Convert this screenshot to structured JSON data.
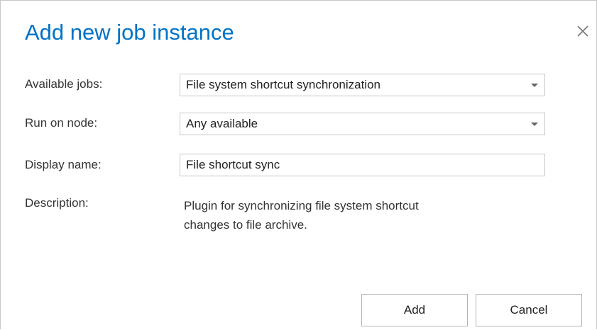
{
  "dialog": {
    "title": "Add new job instance",
    "close_icon": "close-icon"
  },
  "form": {
    "available_jobs": {
      "label": "Available jobs:",
      "value": "File system shortcut synchronization"
    },
    "run_on_node": {
      "label": "Run on node:",
      "value": "Any available"
    },
    "display_name": {
      "label": "Display name:",
      "value": "File shortcut sync"
    },
    "description": {
      "label": "Description:",
      "line1": "Plugin for synchronizing file system shortcut",
      "line2": "changes to file archive."
    }
  },
  "buttons": {
    "add_label": "Add",
    "cancel_label": "Cancel"
  },
  "colors": {
    "title": "#0072c6",
    "text": "#333333",
    "border": "#c6c6c6"
  }
}
